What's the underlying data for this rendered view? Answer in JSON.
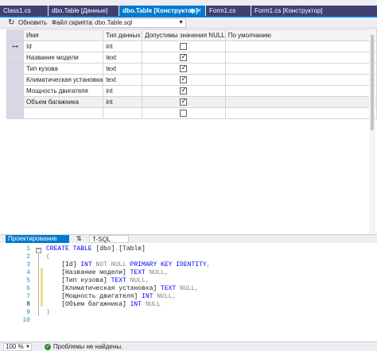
{
  "tabs": [
    {
      "label": "Class1.cs"
    },
    {
      "label": "dbo.Table [Данные]"
    },
    {
      "label": "dbo.Table [Конструктор]",
      "icons": "⊕ ✕"
    },
    {
      "label": "Form1.cs"
    },
    {
      "label": "Form1.cs [Конструктор]"
    }
  ],
  "toolbar": {
    "refresh_label": "Обновить",
    "script_label": "Файл скрипта:",
    "script_value": "dbo.Table.sql"
  },
  "grid": {
    "headers": [
      "Имя",
      "Тип данных",
      "Допустимы значения NULL",
      "По умолчанию"
    ],
    "rows": [
      {
        "name": "Id",
        "type": "int",
        "nullable": false,
        "default": "",
        "key": true
      },
      {
        "name": "Название модели",
        "type": "text",
        "nullable": true,
        "default": "",
        "key": false
      },
      {
        "name": "Тип кузова",
        "type": "text",
        "nullable": true,
        "default": "",
        "key": false
      },
      {
        "name": "Климатическая установка",
        "type": "text",
        "nullable": true,
        "default": "",
        "key": false
      },
      {
        "name": "Мощность двигателя",
        "type": "int",
        "nullable": true,
        "default": "",
        "key": false
      },
      {
        "name": "Объем багажника",
        "type": "int",
        "nullable": true,
        "default": "",
        "key": false
      },
      {
        "name": "",
        "type": "",
        "nullable": false,
        "default": "",
        "key": false
      }
    ]
  },
  "midtabs": {
    "design": "Проектирование",
    "swap": "⇅",
    "tsql": "T-SQL"
  },
  "editor": {
    "line_numbers": [
      "1",
      "2",
      "3",
      "4",
      "5",
      "6",
      "7",
      "8",
      "9",
      "10"
    ],
    "lines": [
      [
        {
          "t": "CREATE TABLE ",
          "c": "kw"
        },
        {
          "t": "[dbo]",
          "c": ""
        },
        {
          "t": ".",
          "c": "gr"
        },
        {
          "t": "[Table]",
          "c": ""
        }
      ],
      [
        {
          "t": "(",
          "c": "gr"
        }
      ],
      [
        {
          "t": "    [Id] ",
          "c": ""
        },
        {
          "t": "INT ",
          "c": "kw"
        },
        {
          "t": "NOT NULL ",
          "c": "gr"
        },
        {
          "t": "PRIMARY KEY IDENTITY",
          "c": "kw"
        },
        {
          "t": ",",
          "c": "gr"
        }
      ],
      [
        {
          "t": "    [Название модели] ",
          "c": ""
        },
        {
          "t": "TEXT ",
          "c": "kw"
        },
        {
          "t": "NULL",
          "c": "gr"
        },
        {
          "t": ",",
          "c": "gr"
        }
      ],
      [
        {
          "t": "    [Тип кузова] ",
          "c": ""
        },
        {
          "t": "TEXT ",
          "c": "kw"
        },
        {
          "t": "NULL",
          "c": "gr"
        },
        {
          "t": ",",
          "c": "gr"
        }
      ],
      [
        {
          "t": "    [Климатическая установка] ",
          "c": ""
        },
        {
          "t": "TEXT ",
          "c": "kw"
        },
        {
          "t": "NULL",
          "c": "gr"
        },
        {
          "t": ",",
          "c": "gr"
        }
      ],
      [
        {
          "t": "    [Мощность двигателя] ",
          "c": ""
        },
        {
          "t": "INT ",
          "c": "kw"
        },
        {
          "t": "NULL",
          "c": "gr"
        },
        {
          "t": ",",
          "c": "gr"
        }
      ],
      [
        {
          "t": "    [Объем багажника] ",
          "c": ""
        },
        {
          "t": "INT ",
          "c": "kw"
        },
        {
          "t": "NULL",
          "c": "gr"
        }
      ],
      [
        {
          "t": ")",
          "c": "gr"
        }
      ],
      [
        {
          "t": "",
          "c": ""
        }
      ]
    ],
    "current_line": 8
  },
  "status": {
    "zoom": "100 %",
    "message": "Проблемы не найдены."
  },
  "colors": {
    "accent": "#007acc",
    "inactive_tab": "#3f3f70",
    "keyword": "#0000ff",
    "ok": "#388a34"
  }
}
